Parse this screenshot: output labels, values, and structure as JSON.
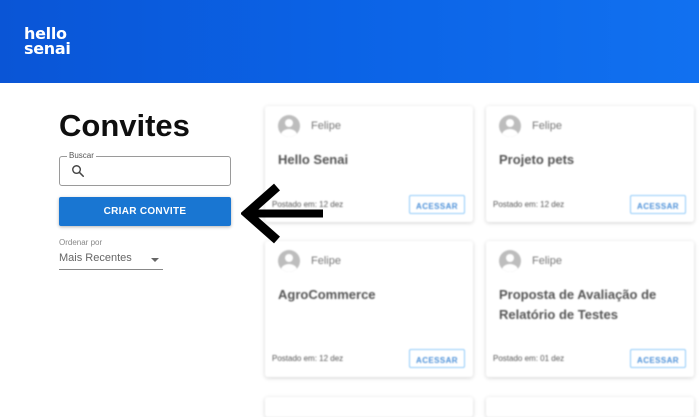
{
  "header": {
    "brand_line1": "hello",
    "brand_line2": "senai",
    "bg_color": "#0b63e6"
  },
  "sidebar": {
    "title": "Convites",
    "search": {
      "label": "Buscar",
      "value": "",
      "icon": "search-icon"
    },
    "create_button": "CRIAR CONVITE",
    "order": {
      "label": "Ordenar por",
      "value": "Mais Recentes"
    }
  },
  "annotation": {
    "icon": "arrow-left-icon"
  },
  "cards": [
    {
      "author": "Felipe",
      "title": "Hello Senai",
      "posted": "Postado em: 12 dez",
      "action": "ACESSAR"
    },
    {
      "author": "Felipe",
      "title": "Projeto pets",
      "posted": "Postado em: 12 dez",
      "action": "ACESSAR"
    },
    {
      "author": "Felipe",
      "title": "AgroCommerce",
      "posted": "Postado em: 12 dez",
      "action": "ACESSAR"
    },
    {
      "author": "Felipe",
      "title": "Proposta de Avaliação de Relatório de Testes",
      "posted": "Postado em: 01 dez",
      "action": "ACESSAR"
    }
  ],
  "colors": {
    "primary": "#1976d2",
    "access": "#4a8fd8"
  }
}
